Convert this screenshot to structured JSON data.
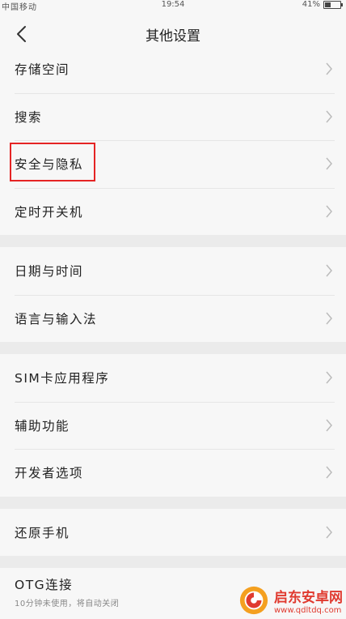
{
  "status_bar": {
    "left": "中国移动",
    "time": "19:54",
    "battery": "41%",
    "battery_level": 0.41
  },
  "nav": {
    "title": "其他设置"
  },
  "groups": [
    {
      "items": [
        {
          "label": "存储空间"
        },
        {
          "label": "搜索"
        },
        {
          "label": "安全与隐私",
          "highlighted": true
        },
        {
          "label": "定时开关机"
        }
      ]
    },
    {
      "items": [
        {
          "label": "日期与时间"
        },
        {
          "label": "语言与输入法"
        }
      ]
    },
    {
      "items": [
        {
          "label": "SIM卡应用程序"
        },
        {
          "label": "辅助功能"
        },
        {
          "label": "开发者选项"
        }
      ]
    },
    {
      "items": [
        {
          "label": "还原手机"
        }
      ]
    },
    {
      "items": [
        {
          "label": "OTG连接",
          "sub": "10分钟未使用，将自动关闭"
        }
      ]
    }
  ],
  "watermark": {
    "name": "启东安卓网",
    "url": "www.qdltdq.com"
  },
  "colors": {
    "highlight": "#e52424",
    "watermark": "#e03a2f"
  }
}
